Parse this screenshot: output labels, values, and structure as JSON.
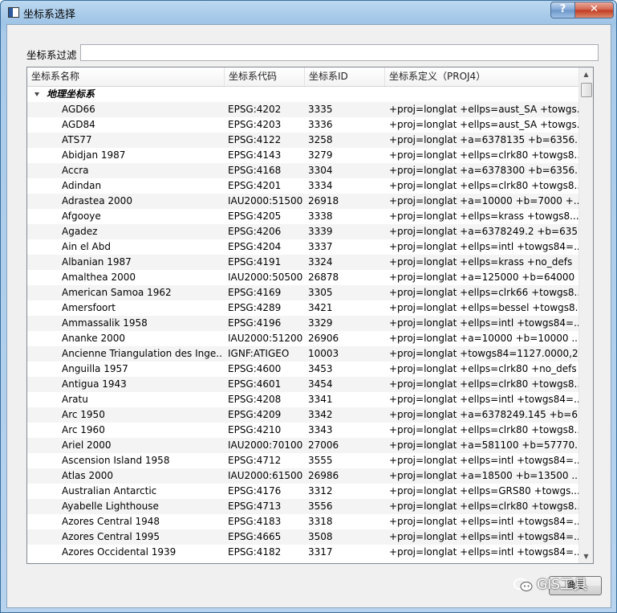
{
  "window": {
    "title": "坐标系选择",
    "help_label": "?",
    "close_label": "✕"
  },
  "filter": {
    "label": "坐标系过滤",
    "value": ""
  },
  "table": {
    "headers": [
      "坐标系名称",
      "坐标系代码",
      "坐标系ID",
      "坐标系定义（PROJ4）"
    ],
    "group": "地理坐标系",
    "rows": [
      [
        "AGD66",
        "EPSG:4202",
        "3335",
        "+proj=longlat +ellps=aust_SA +towgs..."
      ],
      [
        "AGD84",
        "EPSG:4203",
        "3336",
        "+proj=longlat +ellps=aust_SA +towgs..."
      ],
      [
        "ATS77",
        "EPSG:4122",
        "3258",
        "+proj=longlat +a=6378135 +b=6356..."
      ],
      [
        "Abidjan 1987",
        "EPSG:4143",
        "3279",
        "+proj=longlat +ellps=clrk80 +towgs8..."
      ],
      [
        "Accra",
        "EPSG:4168",
        "3304",
        "+proj=longlat +a=6378300 +b=6356..."
      ],
      [
        "Adindan",
        "EPSG:4201",
        "3334",
        "+proj=longlat +ellps=clrk80 +towgs8..."
      ],
      [
        "Adrastea 2000",
        "IAU2000:51500",
        "26918",
        "+proj=longlat +a=10000 +b=7000 +..."
      ],
      [
        "Afgooye",
        "EPSG:4205",
        "3338",
        "+proj=longlat +ellps=krass +towgs8..."
      ],
      [
        "Agadez",
        "EPSG:4206",
        "3339",
        "+proj=longlat +a=6378249.2 +b=635..."
      ],
      [
        "Ain el Abd",
        "EPSG:4204",
        "3337",
        "+proj=longlat +ellps=intl +towgs84=..."
      ],
      [
        "Albanian 1987",
        "EPSG:4191",
        "3324",
        "+proj=longlat +ellps=krass +no_defs"
      ],
      [
        "Amalthea 2000",
        "IAU2000:50500",
        "26878",
        "+proj=longlat +a=125000 +b=64000 ..."
      ],
      [
        "American Samoa 1962",
        "EPSG:4169",
        "3305",
        "+proj=longlat +ellps=clrk66 +towgs8..."
      ],
      [
        "Amersfoort",
        "EPSG:4289",
        "3421",
        "+proj=longlat +ellps=bessel +towgs8..."
      ],
      [
        "Ammassalik 1958",
        "EPSG:4196",
        "3329",
        "+proj=longlat +ellps=intl +towgs84=..."
      ],
      [
        "Ananke 2000",
        "IAU2000:51200",
        "26906",
        "+proj=longlat +a=10000 +b=10000 ..."
      ],
      [
        "Ancienne Triangulation des Inge...",
        "IGNF:ATIGEO",
        "10003",
        "+proj=longlat +towgs84=1127.0000,2..."
      ],
      [
        "Anguilla 1957",
        "EPSG:4600",
        "3453",
        "+proj=longlat +ellps=clrk80 +no_defs"
      ],
      [
        "Antigua 1943",
        "EPSG:4601",
        "3454",
        "+proj=longlat +ellps=clrk80 +towgs8..."
      ],
      [
        "Aratu",
        "EPSG:4208",
        "3341",
        "+proj=longlat +ellps=intl +towgs84=..."
      ],
      [
        "Arc 1950",
        "EPSG:4209",
        "3342",
        "+proj=longlat +a=6378249.145 +b=6..."
      ],
      [
        "Arc 1960",
        "EPSG:4210",
        "3343",
        "+proj=longlat +ellps=clrk80 +towgs8..."
      ],
      [
        "Ariel 2000",
        "IAU2000:70100",
        "27006",
        "+proj=longlat +a=581100 +b=57770..."
      ],
      [
        "Ascension Island 1958",
        "EPSG:4712",
        "3555",
        "+proj=longlat +ellps=intl +towgs84=..."
      ],
      [
        "Atlas 2000",
        "IAU2000:61500",
        "26986",
        "+proj=longlat +a=18500 +b=13500 ..."
      ],
      [
        "Australian Antarctic",
        "EPSG:4176",
        "3312",
        "+proj=longlat +ellps=GRS80 +towgs..."
      ],
      [
        "Ayabelle Lighthouse",
        "EPSG:4713",
        "3556",
        "+proj=longlat +ellps=clrk80 +towgs8..."
      ],
      [
        "Azores Central 1948",
        "EPSG:4183",
        "3318",
        "+proj=longlat +ellps=intl +towgs84=..."
      ],
      [
        "Azores Central 1995",
        "EPSG:4665",
        "3508",
        "+proj=longlat +ellps=intl +towgs84=..."
      ],
      [
        "Azores Occidental 1939",
        "EPSG:4182",
        "3317",
        "+proj=longlat +ellps=intl +towgs84=..."
      ]
    ]
  },
  "buttons": {
    "ok_label": "确定"
  },
  "watermark": {
    "text": "GIS工具"
  }
}
